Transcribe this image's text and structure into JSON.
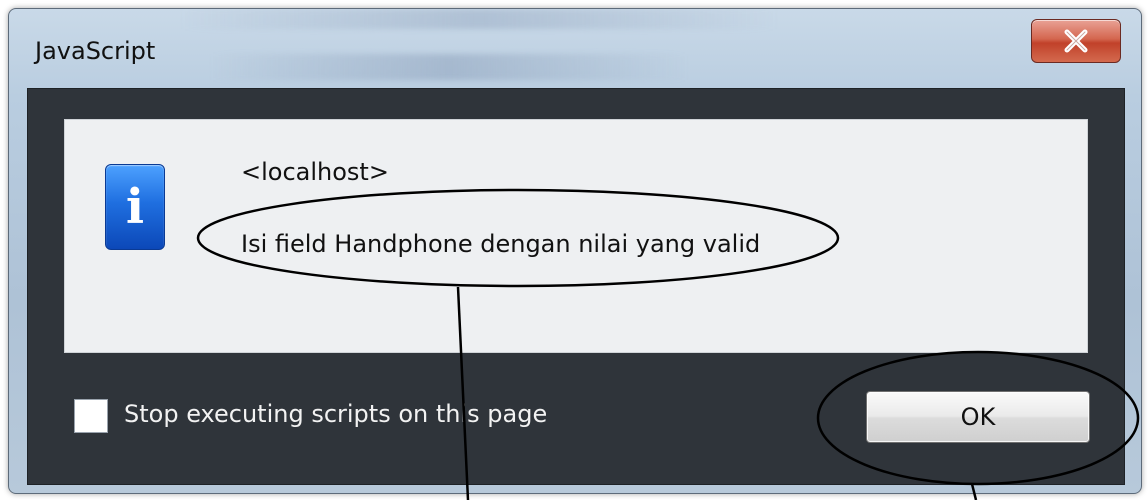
{
  "window": {
    "title": "JavaScript"
  },
  "dialog": {
    "host": "<localhost>",
    "message": "Isi field Handphone dengan nilai yang valid",
    "checkbox_label": "Stop executing scripts on this page",
    "checkbox_checked": false,
    "ok_label": "OK"
  },
  "icons": {
    "close": "close-icon",
    "info": "info-icon"
  },
  "colors": {
    "dialog_body": "#2f343a",
    "content_panel": "#eef0f2",
    "close_button": "#c1412a",
    "info_icon": "#1f6fe0"
  }
}
